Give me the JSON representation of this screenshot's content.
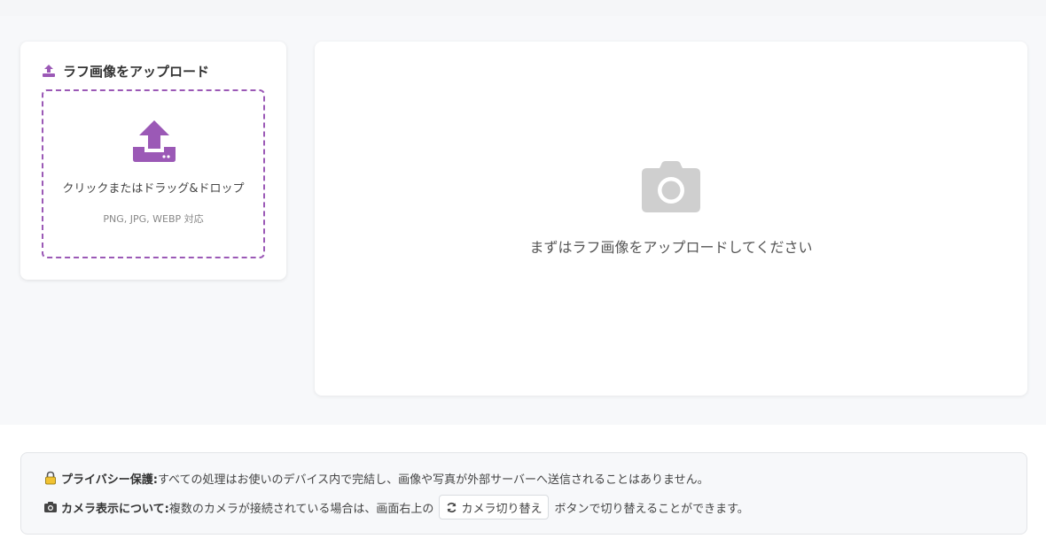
{
  "upload": {
    "title": "ラフ画像をアップロード",
    "title_icon": "upload-icon",
    "dropzone_text": "クリックまたはドラッグ&ドロップ",
    "dropzone_formats": "PNG, JPG, WEBP 対応",
    "dropzone_icon": "upload-large-icon"
  },
  "preview": {
    "icon": "camera-icon",
    "placeholder_text": "まずはラフ画像をアップロードしてください"
  },
  "notice": {
    "privacy_icon": "lock-icon",
    "privacy_head": "プライバシー保護:",
    "privacy_text": "すべての処理はお使いのデバイス内で完結し、画像や写真が外部サーバーへ送信されることはありません。",
    "camera_icon": "camera-small-icon",
    "camera_head": "カメラ表示について:",
    "camera_text_before": "複数のカメラが接続されている場合は、画面右上の",
    "switch_button_label": "カメラ切り替え",
    "switch_button_icon": "refresh-icon",
    "camera_text_after": "ボタンで切り替えることができます。"
  },
  "colors": {
    "accent": "#9b59b6",
    "camera_gray": "#cfcfcf",
    "background": "#f7f8fa"
  }
}
